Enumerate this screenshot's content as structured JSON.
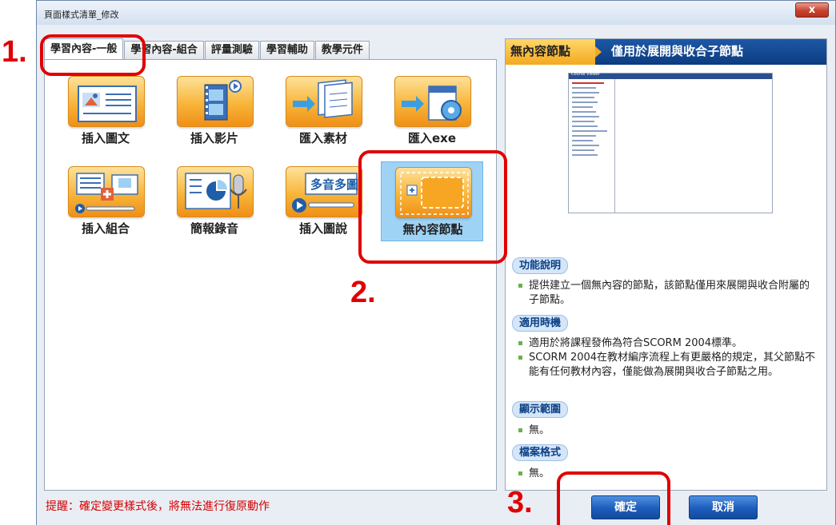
{
  "window": {
    "title": "頁面樣式清單_修改",
    "close_label": "x"
  },
  "tabs": [
    "學習內容-一般",
    "學習內容-組合",
    "評量測驗",
    "學習輔助",
    "教學元件"
  ],
  "items": [
    {
      "label": "插入圖文",
      "icon": "image-text-icon"
    },
    {
      "label": "插入影片",
      "icon": "film-icon"
    },
    {
      "label": "匯入素材",
      "icon": "import-pages-icon"
    },
    {
      "label": "匯入exe",
      "icon": "import-exe-icon"
    },
    {
      "label": "插入組合",
      "icon": "combo-icon"
    },
    {
      "label": "簡報錄音",
      "icon": "presentation-mic-icon"
    },
    {
      "label": "插入圖說",
      "icon": "multi-audio-icon",
      "icon_text": "多音多圖"
    },
    {
      "label": "無內容節點",
      "icon": "empty-node-icon"
    }
  ],
  "detail": {
    "tag": "無內容節點",
    "title": "僅用於展開與收合子節點",
    "preview_title": "Course Viewer",
    "sections": [
      {
        "heading": "功能說明",
        "bullets": [
          "提供建立一個無內容的節點，該節點僅用來展開與收合附屬的子節點。"
        ]
      },
      {
        "heading": "適用時機",
        "bullets": [
          "適用於將課程發佈為符合SCORM 2004標準。",
          "SCORM 2004在教材編序流程上有更嚴格的規定，其父節點不能有任何教材內容，僅能做為展開與收合子節點之用。"
        ]
      },
      {
        "heading": "顯示範圍",
        "bullets": [
          "無。"
        ]
      },
      {
        "heading": "檔案格式",
        "bullets": [
          "無。"
        ]
      }
    ]
  },
  "note": "提醒：確定變更樣式後，將無法進行復原動作",
  "buttons": {
    "ok": "確定",
    "cancel": "取消"
  },
  "annotations": [
    "1.",
    "2.",
    "3."
  ],
  "colors": {
    "accent": "#0c3c80",
    "annotation": "#e00000",
    "warning_text": "#d40000"
  }
}
